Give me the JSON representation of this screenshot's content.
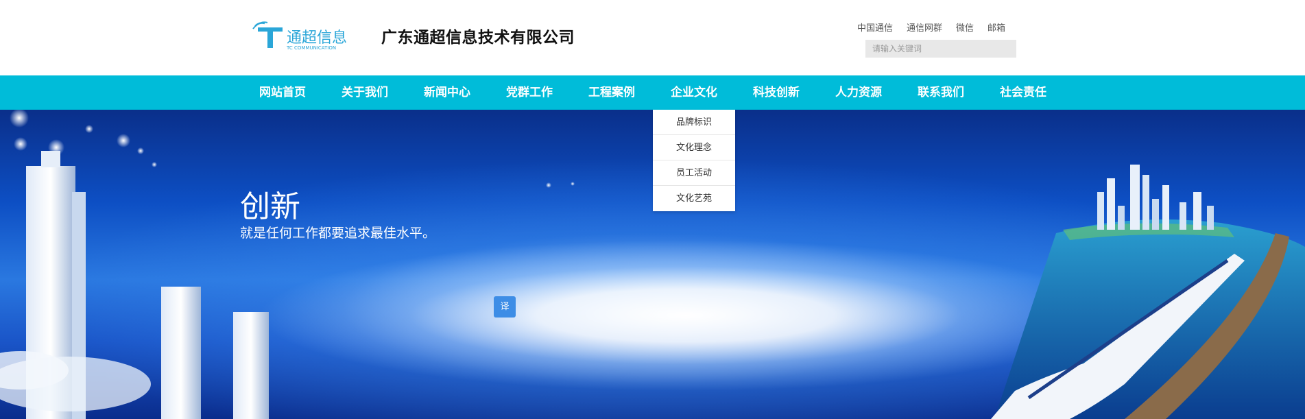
{
  "header": {
    "logo": {
      "text": "通超信息",
      "subtext": "TC COMMUNICATION"
    },
    "company_name": "广东通超信息技术有限公司",
    "top_links": [
      "中国通信",
      "通信网群",
      "微信",
      "邮箱"
    ],
    "search": {
      "placeholder": "请输入关键词",
      "value": ""
    }
  },
  "nav": {
    "items": [
      "网站首页",
      "关于我们",
      "新闻中心",
      "党群工作",
      "工程案例",
      "企业文化",
      "科技创新",
      "人力资源",
      "联系我们",
      "社会责任"
    ],
    "active_dropdown": {
      "parent": "企业文化",
      "items": [
        "品牌标识",
        "文化理念",
        "员工活动",
        "文化艺苑"
      ]
    }
  },
  "banner": {
    "title": "创新",
    "subtitle": "就是任何工作都要追求最佳水平。",
    "translate_button": "译"
  },
  "colors": {
    "nav_bg": "#00bcd9",
    "logo_accent": "#2aa6d8",
    "translate_btn": "#3d8de6"
  }
}
